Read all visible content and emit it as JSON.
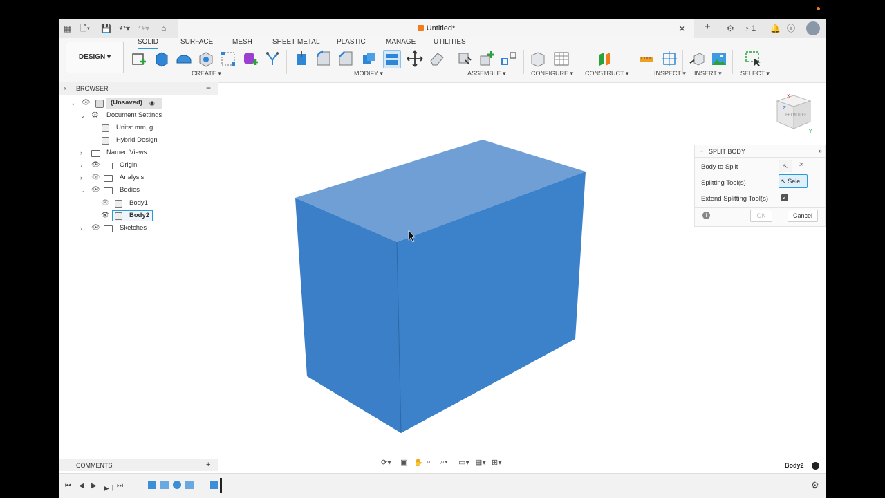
{
  "window": {
    "title": "Untitled*",
    "notifications_count": "1"
  },
  "workspace": {
    "mode_button": "DESIGN ▾",
    "tabs": [
      "SOLID",
      "SURFACE",
      "MESH",
      "SHEET METAL",
      "PLASTIC",
      "MANAGE",
      "UTILITIES"
    ],
    "groups": [
      "CREATE ▾",
      "MODIFY ▾",
      "ASSEMBLE ▾",
      "CONFIGURE ▾",
      "CONSTRUCT ▾",
      "INSPECT ▾",
      "INSERT ▾",
      "SELECT ▾"
    ]
  },
  "browser": {
    "title": "BROWSER",
    "collapse": "−",
    "items": [
      {
        "label": "(Unsaved)"
      },
      {
        "label": "Document Settings"
      },
      {
        "label": "Units: mm, g"
      },
      {
        "label": "Hybrid Design"
      },
      {
        "label": "Named Views"
      },
      {
        "label": "Origin"
      },
      {
        "label": "Analysis"
      },
      {
        "label": "Bodies"
      },
      {
        "label": "Body1"
      },
      {
        "label": "Body2"
      },
      {
        "label": "Sketches"
      }
    ]
  },
  "split_body": {
    "title": "SPLIT BODY",
    "body_to_split_label": "Body to Split",
    "splitting_tools_label": "Splitting Tool(s)",
    "splitting_tools_button": "Sele...",
    "extend_label": "Extend Splitting Tool(s)",
    "extend_checked": true,
    "ok": "OK",
    "cancel": "Cancel"
  },
  "comments": {
    "title": "COMMENTS",
    "add": "+"
  },
  "status": {
    "selected_body": "Body2"
  },
  "viewcube": {
    "faces": [
      "FRONT",
      "LEFT"
    ],
    "axes": [
      "X",
      "Z",
      "Y"
    ]
  },
  "colors": {
    "body_blue": "#3a7fc7",
    "accent": "#2b9bd8"
  }
}
